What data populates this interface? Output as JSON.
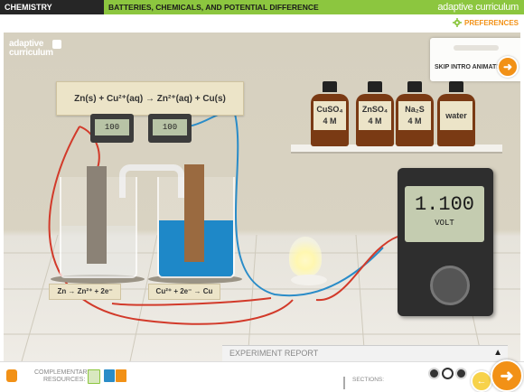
{
  "header": {
    "subject": "CHEMISTRY",
    "title": "BATTERIES, CHEMICALS, AND POTENTIAL DIFFERENCE",
    "brand": "adaptive curriculum"
  },
  "toolbar": {
    "preferences_label": "PREFERENCES"
  },
  "stage": {
    "logo_line1": "adaptive",
    "logo_line2": "curriculum",
    "equation": "Zn(s) + Cu²⁺(aq) → Zn²⁺(aq) + Cu(s)",
    "meter_left": "100",
    "meter_right": "100",
    "half_left": "Zn → Zn²⁺ + 2e⁻",
    "half_right": "Cu²⁺ + 2e⁻ → Cu",
    "bottles": [
      {
        "name": "CuSO₄",
        "conc": "4 M"
      },
      {
        "name": "ZnSO₄",
        "conc": "4 M"
      },
      {
        "name": "Na₂S",
        "conc": "4 M"
      },
      {
        "name": "water",
        "conc": ""
      }
    ],
    "multimeter_value": "1.100",
    "multimeter_unit": "VOLT",
    "skip_label": "SKIP INTRO ANIMATION",
    "report_label": "EXPERIMENT REPORT"
  },
  "footer": {
    "resources_label_1": "COMPLEMENTARY",
    "resources_label_2": "RESOURCES:",
    "sections_label": "SECTIONS:"
  },
  "colors": {
    "accent_green": "#8cc63f",
    "accent_orange": "#f29116",
    "solution_blue": "#1e88c8"
  }
}
